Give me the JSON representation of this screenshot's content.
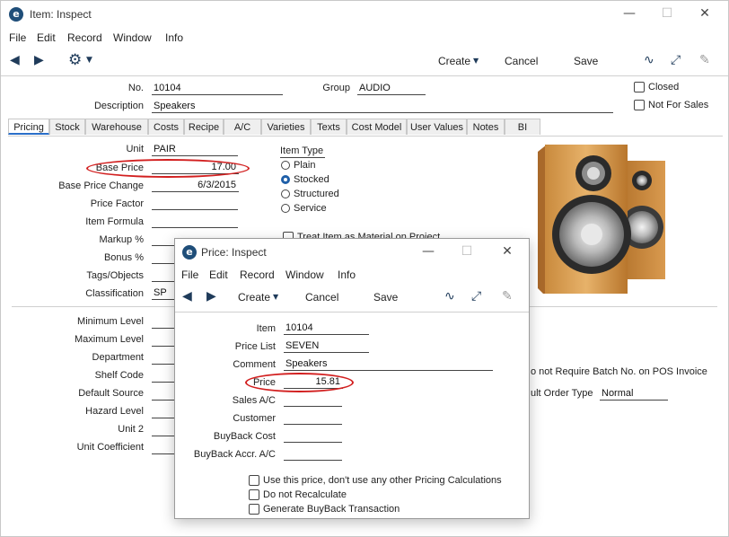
{
  "main": {
    "title": "Item: Inspect",
    "menu": [
      "File",
      "Edit",
      "Record",
      "Window",
      "Info"
    ],
    "toolbar": {
      "create": "Create",
      "cancel": "Cancel",
      "save": "Save"
    },
    "header": {
      "no_label": "No.",
      "no_value": "10104",
      "group_label": "Group",
      "group_value": "AUDIO",
      "desc_label": "Description",
      "desc_value": "Speakers",
      "closed_label": "Closed",
      "nfs_label": "Not For Sales"
    },
    "tabs": [
      "Pricing",
      "Stock",
      "Warehouse",
      "Costs",
      "Recipe",
      "A/C",
      "Varieties",
      "Texts",
      "Cost Model",
      "User Values",
      "Notes",
      "BI"
    ],
    "pricing": {
      "unit_label": "Unit",
      "unit_value": "PAIR",
      "base_price_label": "Base Price",
      "base_price_value": "17.00",
      "bpc_label": "Base Price Change",
      "bpc_value": "6/3/2015",
      "price_factor_label": "Price Factor",
      "item_formula_label": "Item Formula",
      "markup_label": "Markup %",
      "bonus_label": "Bonus %",
      "tags_label": "Tags/Objects",
      "class_label": "Classification",
      "class_value": "SP",
      "item_type_label": "Item Type",
      "types": [
        "Plain",
        "Stocked",
        "Structured",
        "Service"
      ],
      "treat_label": "Treat Item as Material on Project"
    },
    "lower": {
      "min_level": "Minimum Level",
      "max_level": "Maximum Level",
      "department": "Department",
      "shelf_code": "Shelf Code",
      "default_source": "Default Source",
      "hazard_level": "Hazard Level",
      "unit2": "Unit 2",
      "unit_coef": "Unit Coefficient",
      "batch_label": "o not Require Batch No. on POS Invoice",
      "order_type_label": "ult Order Type",
      "order_type_value": "Normal"
    }
  },
  "popup": {
    "title": "Price: Inspect",
    "menu": [
      "File",
      "Edit",
      "Record",
      "Window",
      "Info"
    ],
    "toolbar": {
      "create": "Create",
      "cancel": "Cancel",
      "save": "Save"
    },
    "fields": {
      "item_label": "Item",
      "item_value": "10104",
      "price_list_label": "Price List",
      "price_list_value": "SEVEN",
      "comment_label": "Comment",
      "comment_value": "Speakers",
      "price_label": "Price",
      "price_value": "15.81",
      "sales_ac_label": "Sales A/C",
      "customer_label": "Customer",
      "buyback_cost_label": "BuyBack Cost",
      "buyback_accr_label": "BuyBack Accr. A/C"
    },
    "checks": {
      "use_price": "Use this price, don't use any other Pricing Calculations",
      "no_recalc": "Do not Recalculate",
      "gen_buyback": "Generate BuyBack Transaction"
    }
  }
}
